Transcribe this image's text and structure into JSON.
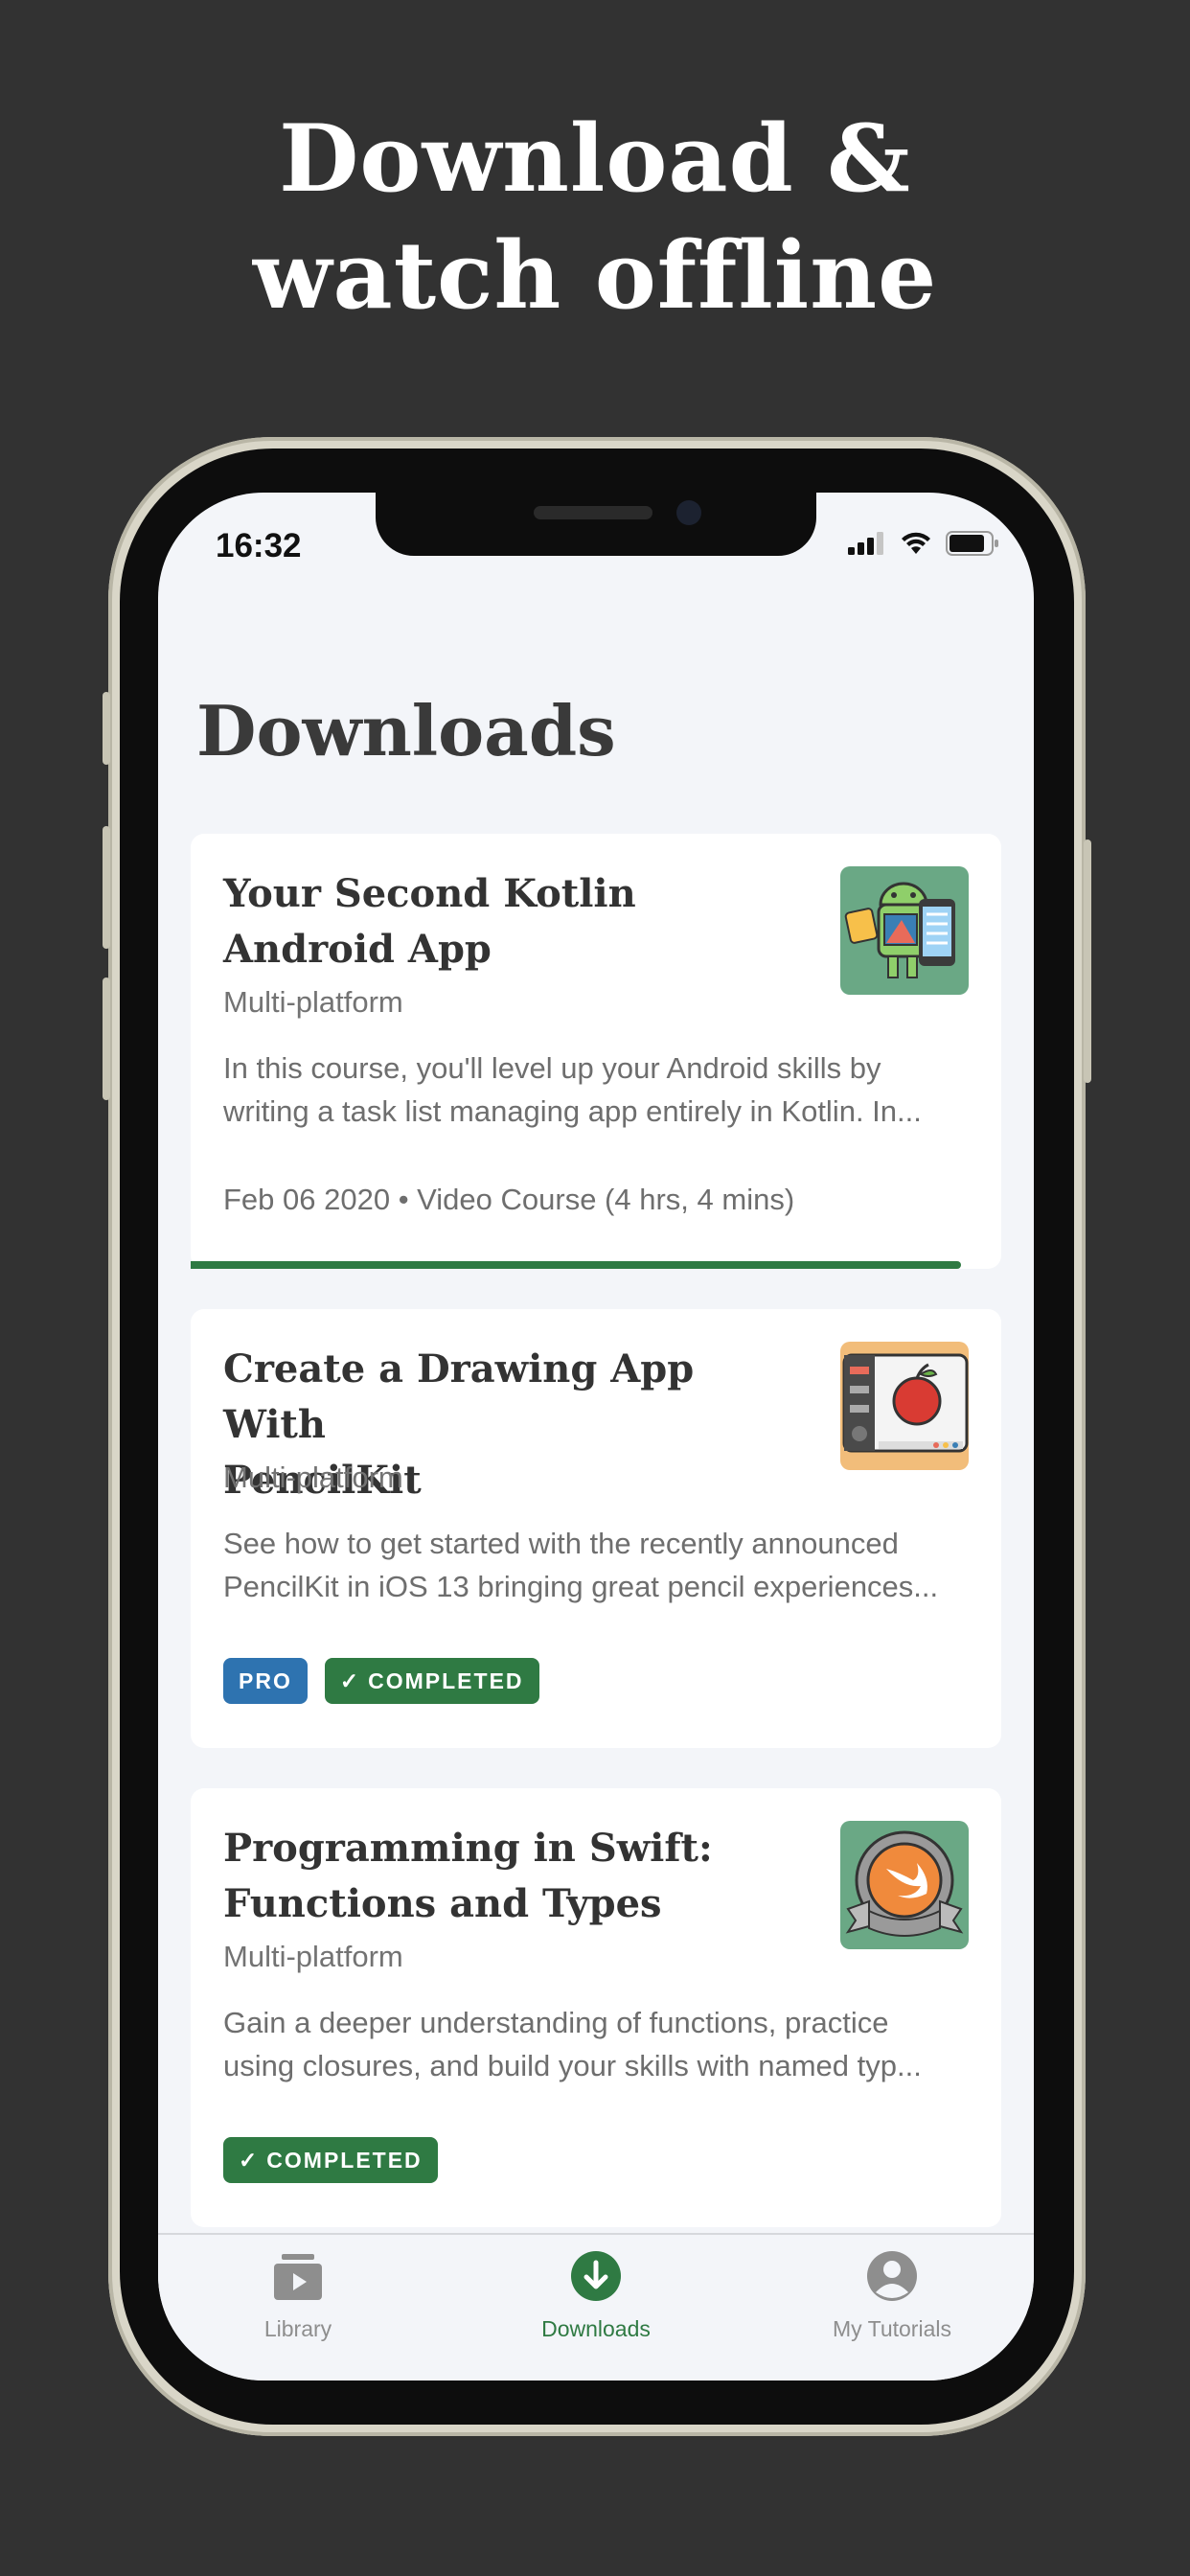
{
  "promo": {
    "line1": "Download &",
    "line2": "watch offline"
  },
  "status_bar": {
    "time": "16:32"
  },
  "page": {
    "title": "Downloads"
  },
  "courses": [
    {
      "title_line1": "Your Second Kotlin",
      "title_line2": "Android App",
      "platform": "Multi-platform",
      "desc_line1": "In this course, you'll level up your Android skills by",
      "desc_line2": "writing a task list managing app entirely in Kotlin. In...",
      "meta": "Feb 06 2020 • Video Course (4 hrs, 4 mins)",
      "progress": 0.95,
      "thumb_bg": "#6aa885"
    },
    {
      "title_line1": "Create a Drawing App With",
      "title_line2": "PencilKit",
      "platform": "Multi-platform",
      "desc_line1": "See how to get started with the recently announced",
      "desc_line2": "PencilKit in iOS 13 bringing great pencil experiences...",
      "tags": [
        "PRO",
        "COMPLETED"
      ],
      "thumb_bg": "#f2bd7a"
    },
    {
      "title_line1": "Programming in Swift:",
      "title_line2": "Functions and Types",
      "platform": "Multi-platform",
      "desc_line1": "Gain a deeper understanding of functions, practice",
      "desc_line2": "using closures, and build your skills with named typ...",
      "tags": [
        "COMPLETED"
      ],
      "thumb_bg": "#6aa885"
    }
  ],
  "tabs": [
    {
      "label": "Library",
      "icon": "library-icon",
      "active": false
    },
    {
      "label": "Downloads",
      "icon": "download-icon",
      "active": true
    },
    {
      "label": "My Tutorials",
      "icon": "profile-icon",
      "active": false
    }
  ],
  "colors": {
    "accent_green": "#2f7a43",
    "pro_blue": "#2e73b0",
    "inactive_tab": "#8e8e8e"
  }
}
